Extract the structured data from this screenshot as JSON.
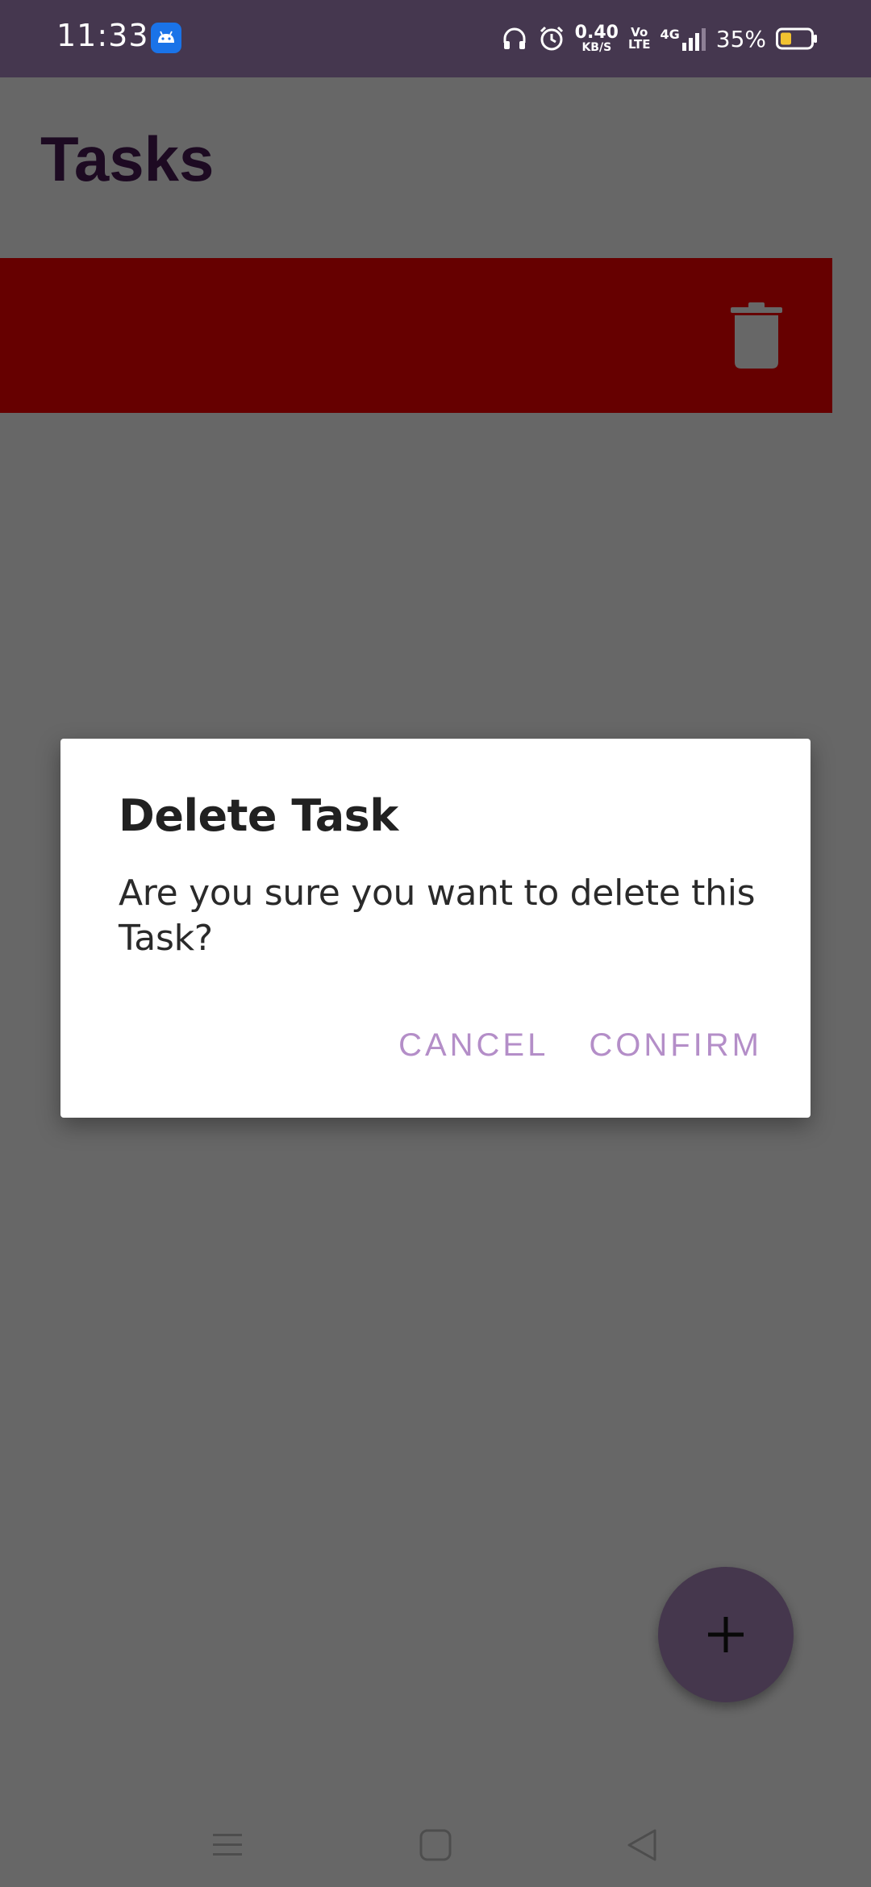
{
  "status_bar": {
    "time": "11:33",
    "net_speed_value": "0.40",
    "net_speed_unit": "KB/S",
    "volte_top": "Vo",
    "volte_bottom": "LTE",
    "network_type": "4G",
    "battery_percent": "35%",
    "icons": [
      "android-debug-icon",
      "headphones-icon",
      "alarm-icon",
      "signal-icon",
      "battery-icon"
    ]
  },
  "app": {
    "title": "Tasks",
    "swipe_action_color": "#cc0000",
    "fab_icon": "plus-icon"
  },
  "dialog": {
    "title": "Delete Task",
    "message": "Are you sure you want to delete this Task?",
    "cancel_label": "CANCEL",
    "confirm_label": "CONFIRM",
    "accent_color": "#b48ec8"
  },
  "nav_bar": {
    "icons": [
      "menu-icon",
      "home-icon",
      "back-icon"
    ]
  }
}
